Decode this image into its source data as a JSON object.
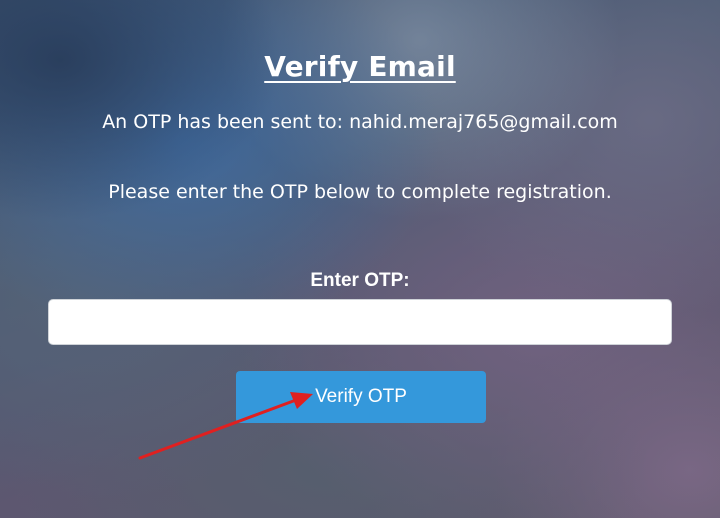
{
  "page": {
    "title": "Verify Email",
    "sent_text": "An OTP has been sent to: nahid.meraj765@gmail.com",
    "instructions": "Please enter the OTP below to complete registration."
  },
  "form": {
    "otp_label": "Enter OTP:",
    "otp_value": "",
    "otp_placeholder": "",
    "submit_label": "Verify OTP"
  },
  "colors": {
    "button": "#3498db",
    "annotation_arrow": "#e02020"
  },
  "annotation": {
    "type": "arrow",
    "points_to": "verify-otp-button"
  }
}
